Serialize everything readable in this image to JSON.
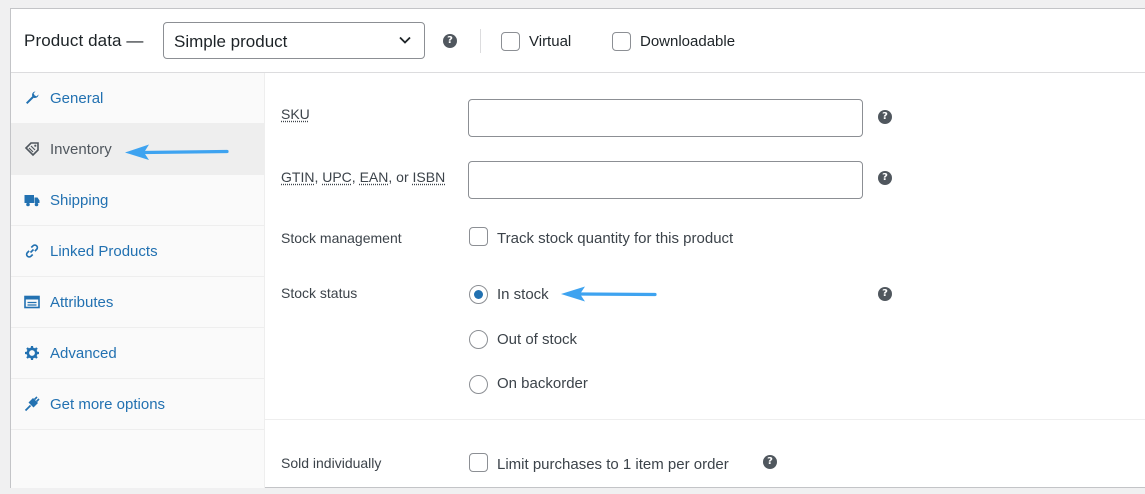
{
  "header": {
    "title": "Product data —",
    "product_type": "Simple product",
    "virtual_label": "Virtual",
    "downloadable_label": "Downloadable",
    "icons": [
      "chevron-down-icon",
      "help-icon"
    ]
  },
  "sidebar": {
    "items": [
      {
        "label": "General",
        "icon": "wrench-icon",
        "active": false
      },
      {
        "label": "Inventory",
        "icon": "tag-icon",
        "active": true
      },
      {
        "label": "Shipping",
        "icon": "truck-icon",
        "active": false
      },
      {
        "label": "Linked Products",
        "icon": "link-icon",
        "active": false
      },
      {
        "label": "Attributes",
        "icon": "list-icon",
        "active": false
      },
      {
        "label": "Advanced",
        "icon": "gear-icon",
        "active": false
      },
      {
        "label": "Get more options",
        "icon": "plugin-icon",
        "active": false
      }
    ]
  },
  "inventory": {
    "sku_label": "SKU",
    "sku_value": "",
    "gtin_label_parts": [
      "GTIN",
      ", ",
      "UPC",
      ", ",
      "EAN",
      ", or ",
      "ISBN"
    ],
    "gtin_value": "",
    "stock_management_label": "Stock management",
    "stock_management_checkbox": "Track stock quantity for this product",
    "stock_management_checked": false,
    "stock_status_label": "Stock status",
    "stock_status_options": [
      "In stock",
      "Out of stock",
      "On backorder"
    ],
    "stock_status_selected": "In stock",
    "sold_individually_label": "Sold individually",
    "sold_individually_checkbox": "Limit purchases to 1 item per order",
    "sold_individually_checked": false
  },
  "colors": {
    "accent": "#2271b1",
    "annotation_arrow": "#3ea3f0",
    "help_icon": "#50575e"
  }
}
